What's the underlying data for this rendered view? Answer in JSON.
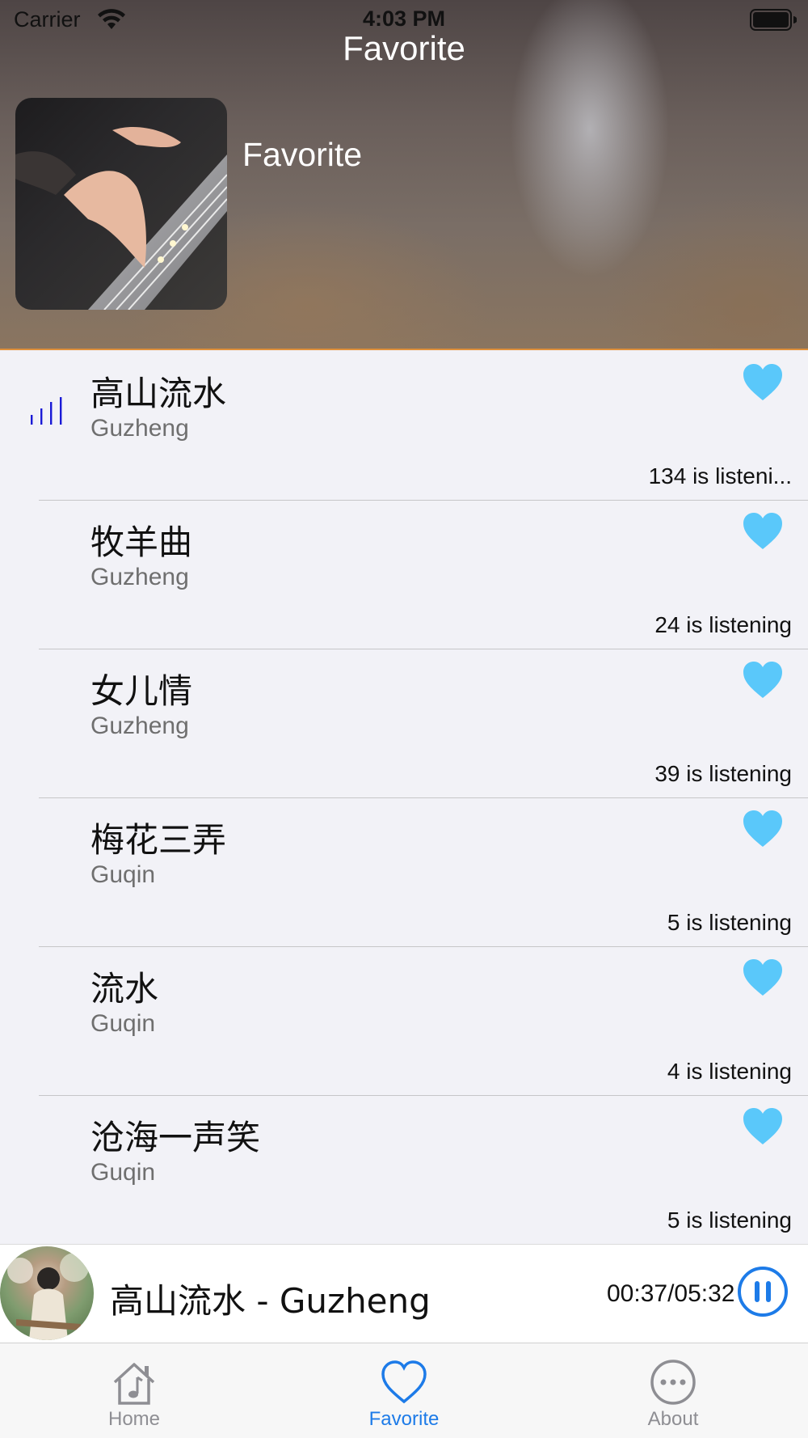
{
  "status_bar": {
    "carrier": "Carrier",
    "time": "4:03 PM"
  },
  "header": {
    "nav_title": "Favorite",
    "album_title": "Favorite"
  },
  "colors": {
    "accent": "#1d7be8",
    "heart": "#5ac8fa",
    "playing_indicator": "#1a1ad6",
    "header_border": "#e0903a"
  },
  "songs": [
    {
      "title": "高山流水",
      "artist": "Guzheng",
      "listening": "134 is listeni...",
      "playing": true
    },
    {
      "title": "牧羊曲",
      "artist": "Guzheng",
      "listening": "24 is listening",
      "playing": false
    },
    {
      "title": "女儿情",
      "artist": "Guzheng",
      "listening": "39 is listening",
      "playing": false
    },
    {
      "title": "梅花三弄",
      "artist": "Guqin",
      "listening": "5 is listening",
      "playing": false
    },
    {
      "title": "流水",
      "artist": "Guqin",
      "listening": "4 is listening",
      "playing": false
    },
    {
      "title": "沧海一声笑",
      "artist": "Guqin",
      "listening": "5 is listening",
      "playing": false
    }
  ],
  "mini_player": {
    "now_playing": "高山流水 - Guzheng",
    "time": "00:37/05:32",
    "state": "playing"
  },
  "tab_bar": {
    "tabs": [
      {
        "label": "Home",
        "icon": "house-music-icon",
        "active": false
      },
      {
        "label": "Favorite",
        "icon": "heart-icon",
        "active": true
      },
      {
        "label": "About",
        "icon": "ellipsis-circle-icon",
        "active": false
      }
    ]
  }
}
